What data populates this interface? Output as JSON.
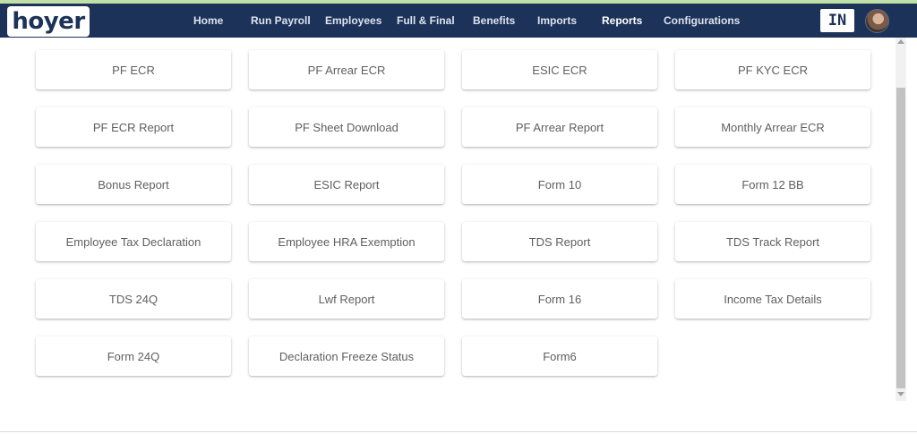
{
  "brand": {
    "logo_text": "hoyer"
  },
  "nav": {
    "items": [
      {
        "label": "Home"
      },
      {
        "label": "Run Payroll"
      },
      {
        "label": "Employees"
      },
      {
        "label": "Full & Final"
      },
      {
        "label": "Benefits"
      },
      {
        "label": "Imports"
      },
      {
        "label": "Reports",
        "active": true
      },
      {
        "label": "Configurations"
      }
    ]
  },
  "header_right": {
    "country_code": "IN"
  },
  "reports": {
    "cards": [
      {
        "label": "PF ECR"
      },
      {
        "label": "PF Arrear ECR"
      },
      {
        "label": "ESIC ECR"
      },
      {
        "label": "PF KYC ECR"
      },
      {
        "label": "PF ECR Report"
      },
      {
        "label": "PF Sheet Download"
      },
      {
        "label": "PF Arrear Report"
      },
      {
        "label": "Monthly Arrear ECR"
      },
      {
        "label": "Bonus Report"
      },
      {
        "label": "ESIC Report"
      },
      {
        "label": "Form 10"
      },
      {
        "label": "Form 12 BB"
      },
      {
        "label": "Employee Tax Declaration"
      },
      {
        "label": "Employee HRA Exemption"
      },
      {
        "label": "TDS Report"
      },
      {
        "label": "TDS Track Report"
      },
      {
        "label": "TDS 24Q"
      },
      {
        "label": "Lwf Report"
      },
      {
        "label": "Form 16"
      },
      {
        "label": "Income Tax Details"
      },
      {
        "label": "Form 24Q"
      },
      {
        "label": "Declaration Freeze Status"
      },
      {
        "label": "Form6"
      }
    ]
  },
  "colors": {
    "navbar_bg": "#1d3258",
    "accent_strip": "#bfe0a8",
    "card_text": "#5f5f5f"
  }
}
